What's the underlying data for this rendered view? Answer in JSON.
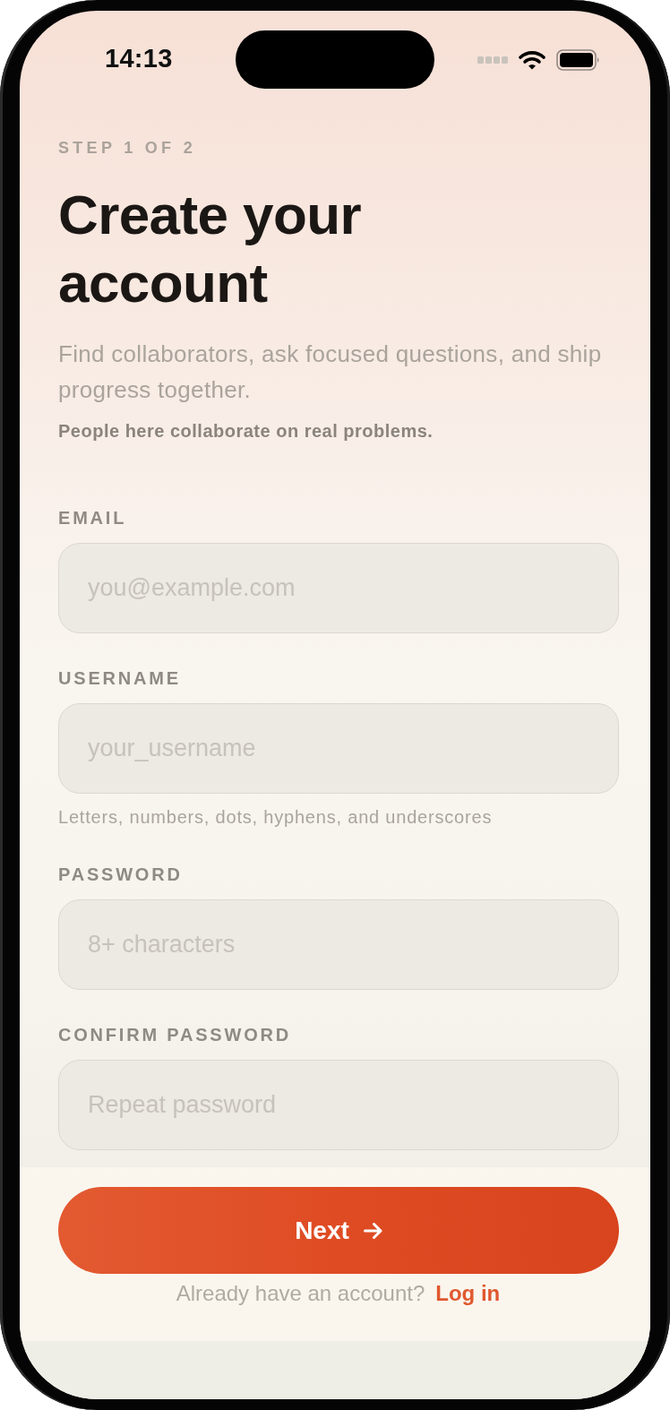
{
  "status_bar": {
    "time": "14:13"
  },
  "header": {
    "step": "STEP 1 OF 2",
    "title": "Create your account",
    "subtitle": "Find collaborators, ask focused questions, and ship progress together.",
    "tagline": "People here collaborate on real problems."
  },
  "fields": [
    {
      "label": "EMAIL",
      "placeholder": "you@example.com"
    },
    {
      "label": "USERNAME",
      "placeholder": "your_username",
      "hint": "Letters, numbers, dots, hyphens, and underscores"
    },
    {
      "label": "PASSWORD",
      "placeholder": "8+ characters"
    },
    {
      "label": "CONFIRM PASSWORD",
      "placeholder": "Repeat password"
    }
  ],
  "next_button": {
    "label": "Next"
  },
  "login_prompt": {
    "text": "Already have an account?",
    "link": "Log in"
  }
}
